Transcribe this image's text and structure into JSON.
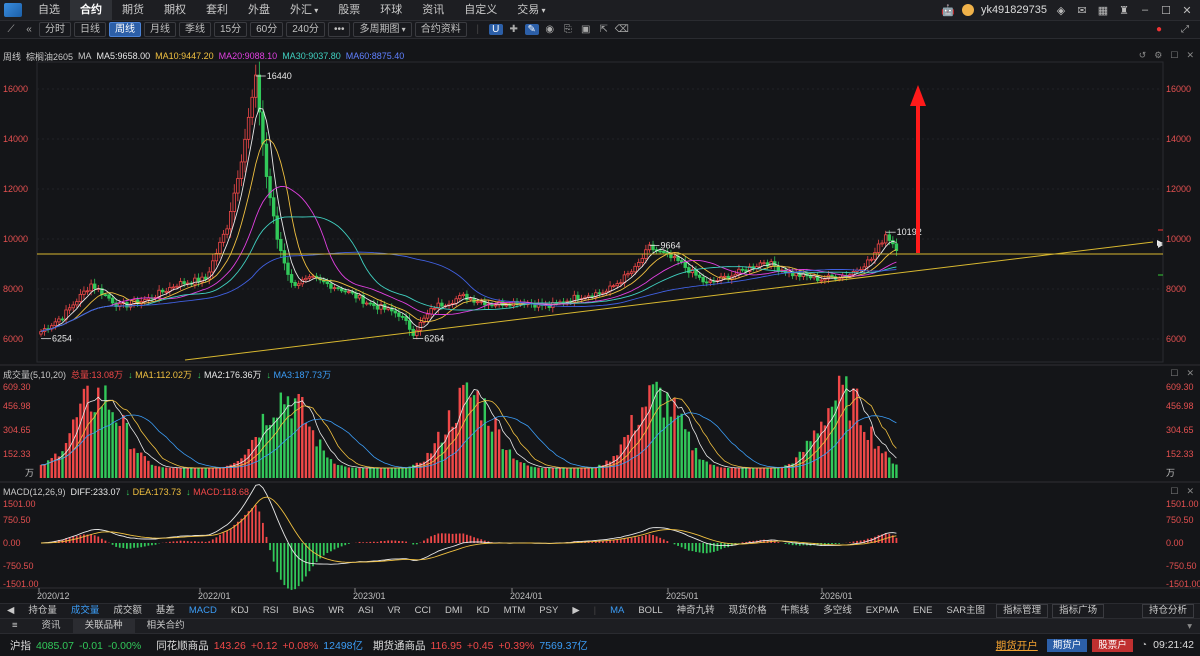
{
  "nav": {
    "items": [
      "自选",
      "合约",
      "期货",
      "期权",
      "套利",
      "外盘",
      "外汇",
      "股票",
      "环球",
      "资讯",
      "自定义",
      "交易"
    ],
    "active_index": 1,
    "caret_items": [
      6,
      11
    ],
    "username": "yk491829735"
  },
  "periods": {
    "items": [
      "分时",
      "日线",
      "周线",
      "月线",
      "季线",
      "15分",
      "60分",
      "240分"
    ],
    "active_index": 2,
    "more_label": "•••",
    "multi_period_label": "多周期图",
    "contract_info_label": "合约资料"
  },
  "main_legend": {
    "period": "周线",
    "symbol": "棕榈油2605",
    "ma_label": "MA",
    "ma5": "MA5:9658.00",
    "ma10": "MA10:9447.20",
    "ma20": "MA20:9088.10",
    "ma30": "MA30:9037.80",
    "ma60": "MA60:8875.40"
  },
  "vol_legend": {
    "name": "成交量(5,10,20)",
    "total": "总量:13.08万",
    "ma1": "MA1:112.02万",
    "ma2": "MA2:176.36万",
    "ma3": "MA3:187.73万"
  },
  "macd_legend": {
    "name": "MACD(12,26,9)",
    "diff": "DIFF:233.07",
    "dea": "DEA:173.73",
    "macd": "MACD:118.68"
  },
  "colors": {
    "ma5": "#e8e8e8",
    "ma10": "#f0c040",
    "ma20": "#e040e0",
    "ma30": "#40d0c0",
    "ma60": "#4060e0",
    "up": "#f04848",
    "down": "#32c85a",
    "arrow": "#ff1a1a",
    "trend": "#d8b830"
  },
  "chart_data": {
    "type": "candlestick",
    "instrument": "棕榈油2605",
    "timeframe": "周线",
    "x_ticks": [
      "2020/12",
      "2022/01",
      "2023/01",
      "2024/01",
      "2025/01",
      "2026/01"
    ],
    "price_axis": [
      6000,
      8000,
      10000,
      12000,
      14000,
      16000
    ],
    "annotations": {
      "low_start": "6254",
      "high": "16440",
      "low_2023": "6264",
      "high_2025": "9664",
      "high_2026": "10192"
    },
    "price_path": [
      [
        0,
        6300
      ],
      [
        6,
        6900
      ],
      [
        14,
        8200
      ],
      [
        22,
        7300
      ],
      [
        30,
        7600
      ],
      [
        38,
        8200
      ],
      [
        46,
        8400
      ],
      [
        52,
        10500
      ],
      [
        56,
        13200
      ],
      [
        60,
        16440
      ],
      [
        63,
        12500
      ],
      [
        66,
        10000
      ],
      [
        70,
        8200
      ],
      [
        76,
        8400
      ],
      [
        84,
        8000
      ],
      [
        92,
        7400
      ],
      [
        100,
        7000
      ],
      [
        104,
        6264
      ],
      [
        110,
        7300
      ],
      [
        118,
        7700
      ],
      [
        126,
        7400
      ],
      [
        134,
        7500
      ],
      [
        142,
        7300
      ],
      [
        150,
        7700
      ],
      [
        158,
        7900
      ],
      [
        166,
        8800
      ],
      [
        170,
        9664
      ],
      [
        178,
        9100
      ],
      [
        186,
        8200
      ],
      [
        194,
        8600
      ],
      [
        202,
        9100
      ],
      [
        210,
        8600
      ],
      [
        218,
        8400
      ],
      [
        226,
        8600
      ],
      [
        232,
        9200
      ],
      [
        236,
        10192
      ],
      [
        239,
        9658
      ]
    ],
    "volume_axis": [
      "609.30",
      "456.98",
      "304.65",
      "152.33"
    ],
    "volume_unit": "万",
    "macd_axis": [
      "1501.00",
      "750.50",
      "0.00",
      "-750.50",
      "-1501.00"
    ]
  },
  "indicators": {
    "left_items": [
      "持仓量",
      "成交量",
      "成交额",
      "基差",
      "MACD",
      "KDJ",
      "RSI",
      "BIAS",
      "WR",
      "ASI",
      "VR",
      "CCI",
      "DMI",
      "KD",
      "MTM",
      "PSY"
    ],
    "left_active": 1,
    "left_active2": 4,
    "right_items": [
      "MA",
      "BOLL",
      "神奇九转",
      "现货价格",
      "牛熊线",
      "多空线",
      "EXPMA",
      "ENE",
      "SAR主图"
    ],
    "right_active": 0,
    "btn_manage": "指标管理",
    "btn_plaza": "指标广场",
    "pos_analysis": "持仓分析"
  },
  "infotabs": [
    "资讯",
    "关联品种",
    "相关合约"
  ],
  "tickers": [
    {
      "name": "沪指",
      "price": "4085.07",
      "chg": "-0.01",
      "pct": "-0.00%",
      "dir": "dn"
    },
    {
      "name": "同花顺商品",
      "price": "143.26",
      "chg": "+0.12",
      "pct": "+0.08%",
      "dir": "up",
      "vol": "12498亿"
    },
    {
      "name": "期货通商品",
      "price": "116.95",
      "chg": "+0.45",
      "pct": "+0.39%",
      "dir": "up",
      "vol": "7569.37亿"
    }
  ],
  "footer": {
    "open_account": "期货开户",
    "futures_user": "期货户",
    "stock_user": "股票户",
    "time": "09:21:42"
  }
}
